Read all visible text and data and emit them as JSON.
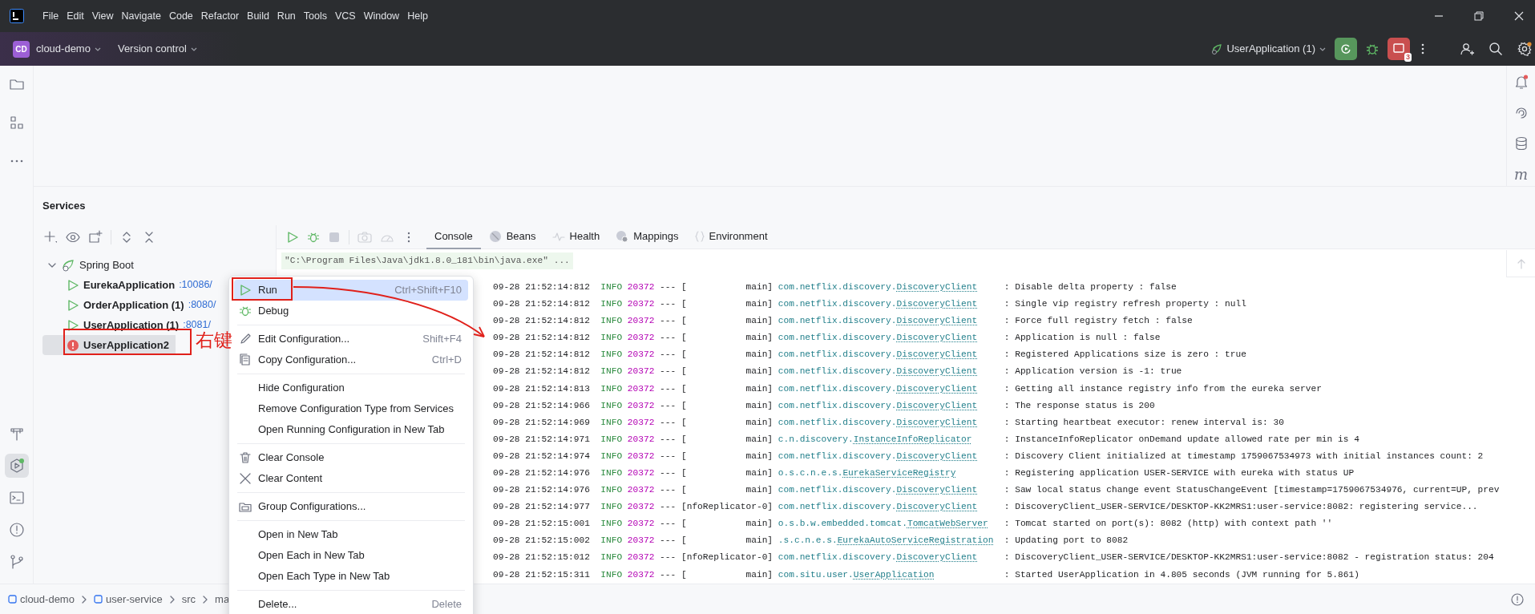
{
  "title_bar": {
    "menu": [
      "File",
      "Edit",
      "View",
      "Navigate",
      "Code",
      "Refactor",
      "Build",
      "Run",
      "Tools",
      "VCS",
      "Window",
      "Help"
    ]
  },
  "toolbar": {
    "project_badge": "CD",
    "project": "cloud-demo",
    "vcs": "Version control",
    "run_config": "UserApplication (1)",
    "stop_count": "3"
  },
  "right_stripe": {
    "maven_label": "m"
  },
  "services": {
    "title": "Services",
    "tree": {
      "group": "Spring Boot",
      "expanded": true,
      "children": [
        {
          "name": "EurekaApplication",
          "port": ":10086/",
          "kind": "running",
          "selected": false
        },
        {
          "name": "OrderApplication (1)",
          "port": ":8080/",
          "kind": "running",
          "selected": false
        },
        {
          "name": "UserApplication (1)",
          "port": ":8081/",
          "kind": "running",
          "selected": false
        },
        {
          "name": "UserApplication2",
          "kind": "error",
          "selected": true
        }
      ]
    },
    "console_tabs": [
      {
        "label": "Console",
        "kind": "plain",
        "selected": true
      },
      {
        "label": "Beans",
        "kind": "beans",
        "selected": false
      },
      {
        "label": "Health",
        "kind": "health",
        "selected": false
      },
      {
        "label": "Mappings",
        "kind": "mappings",
        "selected": false
      },
      {
        "label": "Environment",
        "kind": "environment",
        "selected": false
      }
    ],
    "command_line": "\"C:\\Program Files\\Java\\jdk1.8.0_181\\bin\\java.exe\" ...",
    "log": [
      {
        "time": "09-28 21:52:14:812",
        "level": "INFO",
        "pid": "20372",
        "sep": "---",
        "thread": "[           main]",
        "logger_pkg": "com.netflix.discovery.",
        "logger_class": "DiscoveryClient",
        "message": ": Disable delta property : false"
      },
      {
        "time": "09-28 21:52:14:812",
        "level": "INFO",
        "pid": "20372",
        "sep": "---",
        "thread": "[           main]",
        "logger_pkg": "com.netflix.discovery.",
        "logger_class": "DiscoveryClient",
        "message": ": Single vip registry refresh property : null"
      },
      {
        "time": "09-28 21:52:14:812",
        "level": "INFO",
        "pid": "20372",
        "sep": "---",
        "thread": "[           main]",
        "logger_pkg": "com.netflix.discovery.",
        "logger_class": "DiscoveryClient",
        "message": ": Force full registry fetch : false"
      },
      {
        "time": "09-28 21:52:14:812",
        "level": "INFO",
        "pid": "20372",
        "sep": "---",
        "thread": "[           main]",
        "logger_pkg": "com.netflix.discovery.",
        "logger_class": "DiscoveryClient",
        "message": ": Application is null : false"
      },
      {
        "time": "09-28 21:52:14:812",
        "level": "INFO",
        "pid": "20372",
        "sep": "---",
        "thread": "[           main]",
        "logger_pkg": "com.netflix.discovery.",
        "logger_class": "DiscoveryClient",
        "message": ": Registered Applications size is zero : true"
      },
      {
        "time": "09-28 21:52:14:812",
        "level": "INFO",
        "pid": "20372",
        "sep": "---",
        "thread": "[           main]",
        "logger_pkg": "com.netflix.discovery.",
        "logger_class": "DiscoveryClient",
        "message": ": Application version is -1: true"
      },
      {
        "time": "09-28 21:52:14:813",
        "level": "INFO",
        "pid": "20372",
        "sep": "---",
        "thread": "[           main]",
        "logger_pkg": "com.netflix.discovery.",
        "logger_class": "DiscoveryClient",
        "message": ": Getting all instance registry info from the eureka server"
      },
      {
        "time": "09-28 21:52:14:966",
        "level": "INFO",
        "pid": "20372",
        "sep": "---",
        "thread": "[           main]",
        "logger_pkg": "com.netflix.discovery.",
        "logger_class": "DiscoveryClient",
        "message": ": The response status is 200"
      },
      {
        "time": "09-28 21:52:14:969",
        "level": "INFO",
        "pid": "20372",
        "sep": "---",
        "thread": "[           main]",
        "logger_pkg": "com.netflix.discovery.",
        "logger_class": "DiscoveryClient",
        "message": ": Starting heartbeat executor: renew interval is: 30"
      },
      {
        "time": "09-28 21:52:14:971",
        "level": "INFO",
        "pid": "20372",
        "sep": "---",
        "thread": "[           main]",
        "logger_pkg": "c.n.discovery.",
        "logger_class": "InstanceInfoReplicator",
        "message": ": InstanceInfoReplicator onDemand update allowed rate per min is 4"
      },
      {
        "time": "09-28 21:52:14:974",
        "level": "INFO",
        "pid": "20372",
        "sep": "---",
        "thread": "[           main]",
        "logger_pkg": "com.netflix.discovery.",
        "logger_class": "DiscoveryClient",
        "message": ": Discovery Client initialized at timestamp 1759067534973 with initial instances count: 2"
      },
      {
        "time": "09-28 21:52:14:976",
        "level": "INFO",
        "pid": "20372",
        "sep": "---",
        "thread": "[           main]",
        "logger_pkg": "o.s.c.n.e.s.",
        "logger_class": "EurekaServiceRegistry",
        "message": ": Registering application USER-SERVICE with eureka with status UP"
      },
      {
        "time": "09-28 21:52:14:976",
        "level": "INFO",
        "pid": "20372",
        "sep": "---",
        "thread": "[           main]",
        "logger_pkg": "com.netflix.discovery.",
        "logger_class": "DiscoveryClient",
        "message": ": Saw local status change event StatusChangeEvent [timestamp=1759067534976, current=UP, prev"
      },
      {
        "time": "09-28 21:52:14:977",
        "level": "INFO",
        "pid": "20372",
        "sep": "---",
        "thread": "[nfoReplicator-0]",
        "logger_pkg": "com.netflix.discovery.",
        "logger_class": "DiscoveryClient",
        "message": ": DiscoveryClient_USER-SERVICE/DESKTOP-KK2MRS1:user-service:8082: registering service..."
      },
      {
        "time": "09-28 21:52:15:001",
        "level": "INFO",
        "pid": "20372",
        "sep": "---",
        "thread": "[           main]",
        "logger_pkg": "o.s.b.w.embedded.tomcat.",
        "logger_class": "TomcatWebServer",
        "message": ": Tomcat started on port(s): 8082 (http) with context path ''"
      },
      {
        "time": "09-28 21:52:15:002",
        "level": "INFO",
        "pid": "20372",
        "sep": "---",
        "thread": "[           main]",
        "logger_pkg": ".s.c.n.e.s.",
        "logger_class": "EurekaAutoServiceRegistration",
        "message": ": Updating port to 8082"
      },
      {
        "time": "09-28 21:52:15:012",
        "level": "INFO",
        "pid": "20372",
        "sep": "---",
        "thread": "[nfoReplicator-0]",
        "logger_pkg": "com.netflix.discovery.",
        "logger_class": "DiscoveryClient",
        "message": ": DiscoveryClient_USER-SERVICE/DESKTOP-KK2MRS1:user-service:8082 - registration status: 204"
      },
      {
        "time": "09-28 21:52:15:311",
        "level": "INFO",
        "pid": "20372",
        "sep": "---",
        "thread": "[           main]",
        "logger_pkg": "com.situ.user.",
        "logger_class": "UserApplication",
        "message": ": Started UserApplication in 4.805 seconds (JVM running for 5.861)"
      }
    ]
  },
  "context_menu": {
    "items": [
      {
        "kind": "run",
        "label": "Run",
        "shortcut": "Ctrl+Shift+F10",
        "highlighted": true
      },
      {
        "kind": "debug",
        "label": "Debug",
        "highlighted": false
      },
      {
        "kind": "separator"
      },
      {
        "kind": "edit",
        "label": "Edit Configuration...",
        "shortcut": "Shift+F4",
        "highlighted": false
      },
      {
        "kind": "copy",
        "label": "Copy Configuration...",
        "shortcut": "Ctrl+D",
        "highlighted": false
      },
      {
        "kind": "separator"
      },
      {
        "kind": "plain",
        "label": "Hide Configuration",
        "highlighted": false
      },
      {
        "kind": "plain",
        "label": "Remove Configuration Type from Services",
        "highlighted": false
      },
      {
        "kind": "plain",
        "label": "Open Running Configuration in New Tab",
        "highlighted": false
      },
      {
        "kind": "separator"
      },
      {
        "kind": "trash",
        "label": "Clear Console",
        "highlighted": false
      },
      {
        "kind": "clear",
        "label": "Clear Content",
        "highlighted": false
      },
      {
        "kind": "separator"
      },
      {
        "kind": "group",
        "label": "Group Configurations...",
        "highlighted": false
      },
      {
        "kind": "separator"
      },
      {
        "kind": "plain",
        "label": "Open in New Tab",
        "highlighted": false
      },
      {
        "kind": "plain",
        "label": "Open Each in New Tab",
        "highlighted": false
      },
      {
        "kind": "plain",
        "label": "Open Each Type in New Tab",
        "highlighted": false
      },
      {
        "kind": "separator"
      },
      {
        "kind": "plain",
        "label": "Delete...",
        "shortcut": "Delete",
        "highlighted": false
      }
    ]
  },
  "annotation": {
    "label": "右键"
  },
  "breadcrumb": [
    {
      "label": "cloud-demo",
      "kind": "module"
    },
    {
      "label": "user-service",
      "kind": "module"
    },
    {
      "label": "src",
      "kind": "folder"
    },
    {
      "label": "ma",
      "kind": "folder"
    }
  ]
}
